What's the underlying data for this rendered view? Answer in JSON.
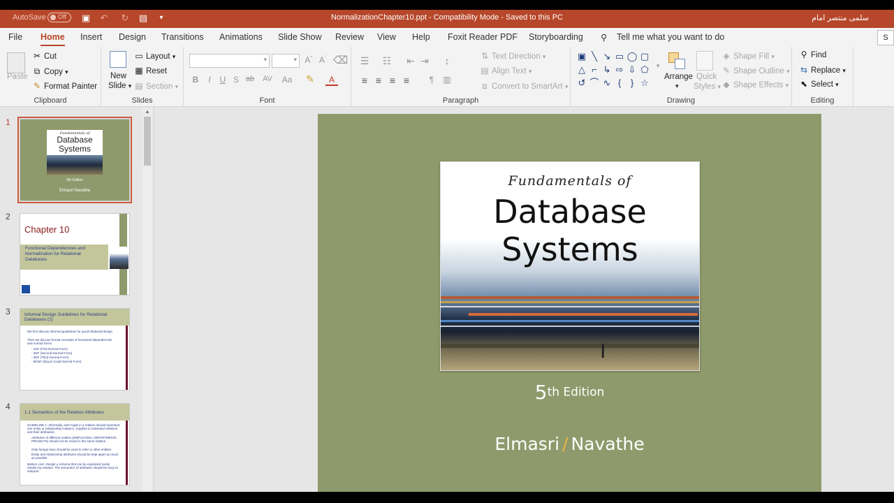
{
  "titlebar": {
    "autosave_label": "AutoSave",
    "autosave_state": "Off",
    "document_title": "NormalizationChapter10.ppt  -  Compatibility Mode  -  Saved to this PC",
    "user_name": "سلمى منتصر امام"
  },
  "tabs": [
    {
      "label": "File"
    },
    {
      "label": "Home"
    },
    {
      "label": "Insert"
    },
    {
      "label": "Design"
    },
    {
      "label": "Transitions"
    },
    {
      "label": "Animations"
    },
    {
      "label": "Slide Show"
    },
    {
      "label": "Review"
    },
    {
      "label": "View"
    },
    {
      "label": "Help"
    },
    {
      "label": "Foxit Reader PDF"
    },
    {
      "label": "Storyboarding"
    }
  ],
  "tell_me": "Tell me what you want to do",
  "share_label": "S",
  "ribbon": {
    "clipboard": {
      "label": "Clipboard",
      "paste": "Paste",
      "cut": "Cut",
      "copy": "Copy",
      "format_painter": "Format Painter"
    },
    "slides": {
      "label": "Slides",
      "new_slide_1": "New",
      "new_slide_2": "Slide",
      "layout": "Layout",
      "reset": "Reset",
      "section": "Section"
    },
    "font": {
      "label": "Font",
      "bold": "B",
      "italic": "I",
      "underline": "U",
      "shadow": "S",
      "strike": "ab",
      "spacing": "AV",
      "case": "Aa"
    },
    "paragraph": {
      "label": "Paragraph",
      "text_direction": "Text Direction",
      "align_text": "Align Text",
      "convert_smartart": "Convert to SmartArt"
    },
    "drawing": {
      "label": "Drawing",
      "arrange": "Arrange",
      "quick_styles_1": "Quick",
      "quick_styles_2": "Styles",
      "shape_fill": "Shape Fill",
      "shape_outline": "Shape Outline",
      "shape_effects": "Shape Effects"
    },
    "editing": {
      "label": "Editing",
      "find": "Find",
      "replace": "Replace",
      "select": "Select"
    }
  },
  "slides": [
    {
      "number": "1",
      "title_small": "Fundamentals of",
      "title_1": "Database",
      "title_2": "Systems",
      "edition": "5th Edition",
      "authors": "Elmasri  Navathe"
    },
    {
      "number": "2",
      "heading": "Chapter 10",
      "subtitle": "Functional Dependencies and Normalization for Relational Databases"
    },
    {
      "number": "3",
      "heading": "Informal Design Guidelines for Relational Databases (2)",
      "bullets": [
        "We first discuss informal guidelines for good relational design",
        "Then we discuss formal concepts of functional dependencies and normal forms",
        "- 1NF (First Normal Form)",
        "- 2NF (Second Normal Form)",
        "- 3NF (Third Normal Form)",
        "- BCNF (Boyce-Codd Normal Form)"
      ]
    },
    {
      "number": "4",
      "heading": "1.1   Semantics of the Relation Attributes",
      "bullets": [
        "GUIDELINE 1: Informally, each tuple in a relation should represent one entity or relationship instance. (Applies to individual relations and their attributes).",
        "Attributes of different entities (EMPLOYEEs, DEPARTMENTs, PROJECTs) should not be mixed in the same relation",
        "Only foreign keys should be used to refer to other entities",
        "Entity and relationship attributes should be kept apart as much as possible.",
        "Bottom Line: Design a schema that can be explained easily relation by relation. The semantics of attributes should be easy to interpret."
      ]
    }
  ],
  "main_slide": {
    "cover_small": "Fundamentals of",
    "cover_title_1": "Database",
    "cover_title_2": "Systems",
    "edition_num": "5",
    "edition_rest": "th Edition",
    "author_1": "Elmasri",
    "author_sep": "/",
    "author_2": "Navathe",
    "background_color": "#8e9a6b"
  },
  "colors": {
    "accent": "#b7472a",
    "slide_green": "#8e9a6b"
  }
}
